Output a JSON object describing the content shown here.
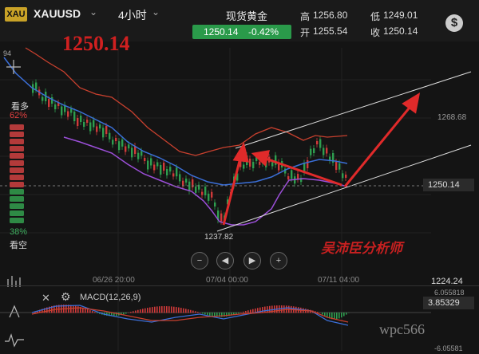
{
  "header": {
    "badge": "XAU",
    "symbol": "XAUUSD",
    "timeframe": "4小时",
    "quote_name": "现货黄金",
    "price": "1250.14",
    "change": "-0.42%",
    "high_label": "高",
    "high": "1256.80",
    "low_label": "低",
    "low": "1249.01",
    "open_label": "开",
    "open": "1255.54",
    "close_label": "收",
    "close": "1250.14"
  },
  "overlay": {
    "big_price": "1250.14",
    "signature": "吴沛臣分析师",
    "watermark": "wpc566",
    "low_marker": "1237.82"
  },
  "sentiment": {
    "bull_label": "看多",
    "bull_pct": "62%",
    "bear_pct": "38%",
    "bear_label": "看空",
    "bull_value": 0.62
  },
  "axis": {
    "y_upper": "1268.68",
    "y_current": "1250.14",
    "y_bottom": "1224.24",
    "top_left_tick": "94",
    "x_labels": [
      "06/26 20:00",
      "07/04 00:00",
      "07/11 04:00"
    ],
    "macd_y_top": "6.055818",
    "macd_y_box": "3.85329",
    "macd_y_bottom": "-6.05581"
  },
  "macd": {
    "label": "MACD(12,26,9)"
  },
  "colors": {
    "up": "#2e9e4f",
    "down": "#d03a3a",
    "mid_band": "#3b6fd8",
    "upper_band": "#c8402e",
    "lower_band": "#9b4fd8",
    "arrow": "#e02a2a"
  },
  "icons": {
    "dollar": "dollar-icon",
    "minus": "zoom-out-icon",
    "prev": "step-back-icon",
    "next": "step-forward-icon",
    "plus": "zoom-in-icon"
  }
}
